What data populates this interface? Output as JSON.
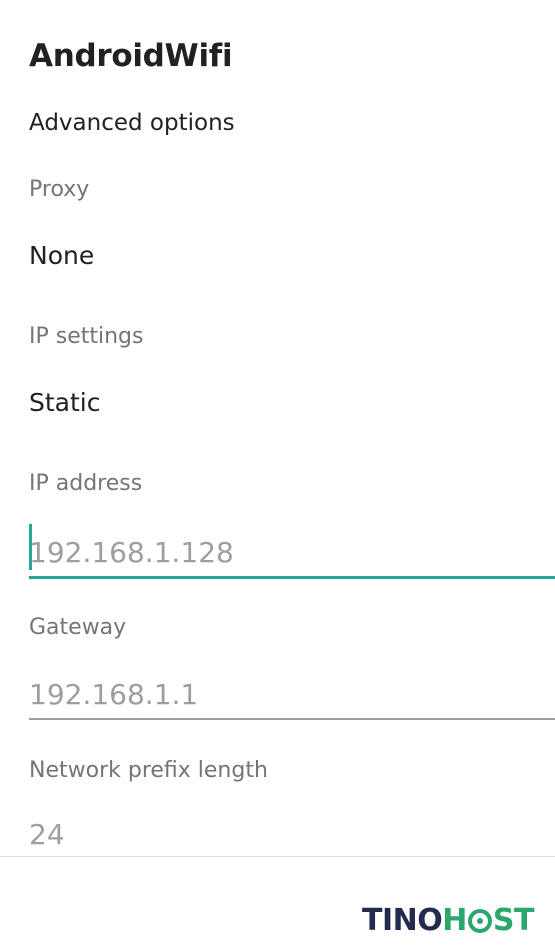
{
  "dialog": {
    "title": "AndroidWifi",
    "advanced_options": "Advanced options"
  },
  "proxy": {
    "label": "Proxy",
    "value": "None"
  },
  "ip_settings": {
    "label": "IP settings",
    "value": "Static"
  },
  "ip_address": {
    "label": "IP address",
    "placeholder": "192.168.1.128"
  },
  "gateway": {
    "label": "Gateway",
    "placeholder": "192.168.1.1"
  },
  "network_prefix": {
    "label": "Network prefix length",
    "placeholder": "24"
  },
  "watermark": {
    "part1": "TINO",
    "part2a": "H",
    "part2b": "ST"
  },
  "colors": {
    "accent": "#26a69a",
    "text_primary": "#212121",
    "text_secondary": "#757575",
    "logo_dark": "#232b4e",
    "logo_green": "#2aa86b"
  }
}
